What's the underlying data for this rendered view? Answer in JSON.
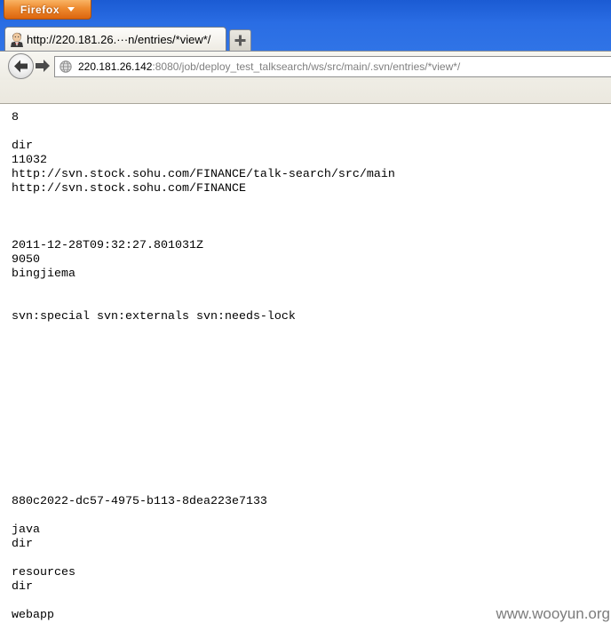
{
  "window": {
    "menu_button_label": "Firefox",
    "menu_button_icon": "dropdown-arrow-icon"
  },
  "tabs": [
    {
      "title": "http://220.181.26.···n/entries/*view*/",
      "favicon": "jenkins-butler-icon",
      "selected": true
    }
  ],
  "tab_strip": {
    "new_tab_icon": "plus-icon"
  },
  "navigation": {
    "back_icon": "back-arrow-icon",
    "forward_icon": "forward-arrow-icon",
    "site_identity_icon": "globe-icon",
    "url_host": "220.181.26.142",
    "url_rest": ":8080/job/deploy_test_talksearch/ws/src/main/.svn/entries/*view*/"
  },
  "content": {
    "text": "8\n\ndir\n11032\nhttp://svn.stock.sohu.com/FINANCE/talk-search/src/main\nhttp://svn.stock.sohu.com/FINANCE\n\n\n\n2011-12-28T09:32:27.801031Z\n9050\nbingjiema\n\n\nsvn:special svn:externals svn:needs-lock\n\n\n\n\n\n\n\n\n\n\n\n\n880c2022-dc57-4975-b113-8dea223e7133\n\njava\ndir\n\nresources\ndir\n\nwebapp\ndir"
  },
  "watermark": {
    "text": "www.wooyun.org"
  },
  "colors": {
    "window_frame": "#2a6de4",
    "menu_button": "#ee8a2f",
    "url_host": "#000000",
    "url_rest": "#7f7f7f",
    "page_background": "#ffffff",
    "watermark": "#6e6e6e"
  }
}
